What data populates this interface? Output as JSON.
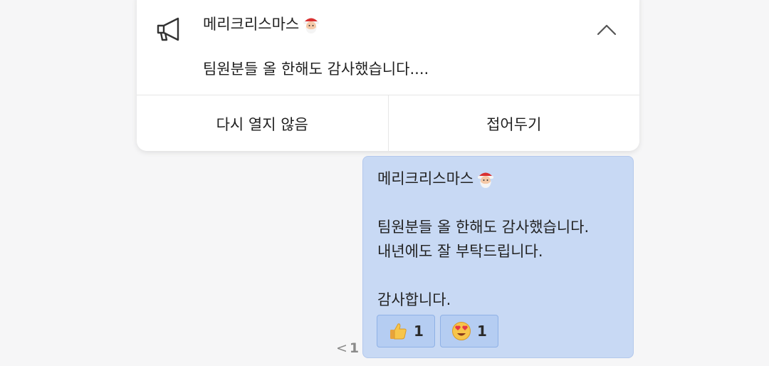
{
  "notice": {
    "title": "메리크리스마스",
    "title_emoji": "santa-emoji",
    "preview": "팀원분들 올 한해도 감사했습니다....",
    "icon": "megaphone-icon",
    "collapse_icon": "chevron-up-icon",
    "actions": {
      "dont_show_label": "다시 열지 않음",
      "fold_label": "접어두기"
    }
  },
  "message": {
    "lines": [
      "메리크리스마스",
      "",
      "팀원분들 올 한해도 감사했습니다.",
      "내년에도 잘 부탁드립니다.",
      "",
      "감사합니다."
    ],
    "reactions": [
      {
        "emoji": "thumbs-up-emoji",
        "count": "1"
      },
      {
        "emoji": "heart-eyes-emoji",
        "count": "1"
      }
    ],
    "unread_marker": "<",
    "unread_count": "1"
  },
  "colors": {
    "bubble": "#c8d9f4",
    "reaction_bg": "#b5cdf2",
    "card": "#ffffff",
    "background": "#f6f6f7"
  }
}
